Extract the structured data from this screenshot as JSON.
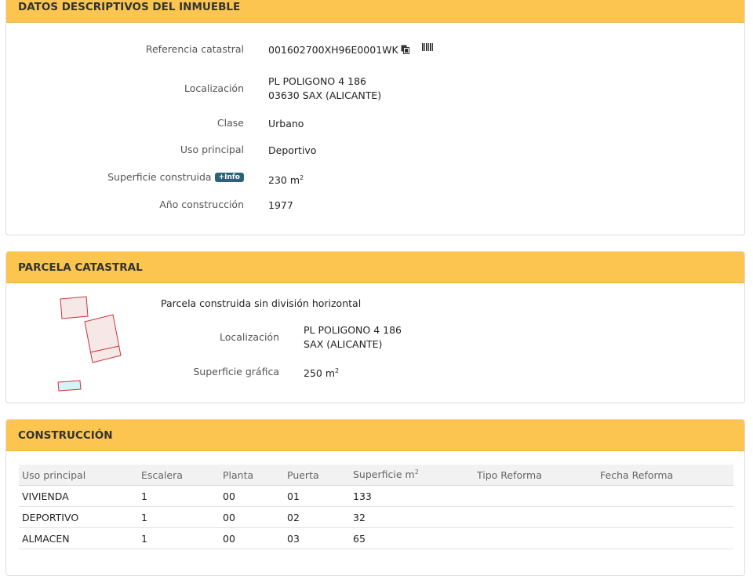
{
  "datos": {
    "title": "DATOS DESCRIPTIVOS DEL INMUEBLE",
    "rows": {
      "referencia": {
        "label": "Referencia catastral",
        "value": "001602700XH96E0001WK"
      },
      "localizacion": {
        "label": "Localización",
        "line1": "PL POLIGONO 4 186",
        "line2": "03630 SAX (ALICANTE)"
      },
      "clase": {
        "label": "Clase",
        "value": "Urbano"
      },
      "uso": {
        "label": "Uso principal",
        "value": "Deportivo"
      },
      "superficie": {
        "label": "Superficie construida",
        "badge": "+Info",
        "value": "230 m",
        "unit_sup": "2"
      },
      "anio": {
        "label": "Año construcción",
        "value": "1977"
      }
    },
    "icons": [
      "copy-icon",
      "barcode-icon"
    ]
  },
  "parcela": {
    "title": "PARCELA CATASTRAL",
    "subtitle": "Parcela construida sin división horizontal",
    "localizacion": {
      "label": "Localización",
      "line1": "PL POLIGONO 4 186",
      "line2": "SAX (ALICANTE)"
    },
    "superficie": {
      "label": "Superficie gráfica",
      "value": "250 m",
      "unit_sup": "2"
    }
  },
  "construccion": {
    "title": "CONSTRUCCIÓN",
    "headers": {
      "uso": "Uso principal",
      "escalera": "Escalera",
      "planta": "Planta",
      "puerta": "Puerta",
      "superficie": "Superficie m",
      "superficie_sup": "2",
      "tipo": "Tipo Reforma",
      "fecha": "Fecha Reforma"
    },
    "rows": [
      {
        "uso": "VIVIENDA",
        "escalera": "1",
        "planta": "00",
        "puerta": "01",
        "superficie": "133",
        "tipo": "",
        "fecha": ""
      },
      {
        "uso": "DEPORTIVO",
        "escalera": "1",
        "planta": "00",
        "puerta": "02",
        "superficie": "32",
        "tipo": "",
        "fecha": ""
      },
      {
        "uso": "ALMACEN",
        "escalera": "1",
        "planta": "00",
        "puerta": "03",
        "superficie": "65",
        "tipo": "",
        "fecha": ""
      }
    ]
  },
  "colors": {
    "header": "#fbc54f",
    "badge": "#2a6478",
    "parcel_stroke": "#cc3333",
    "parcel_fill": "#f5e4e4",
    "parcel_fill_blue": "#d9f2f7"
  }
}
